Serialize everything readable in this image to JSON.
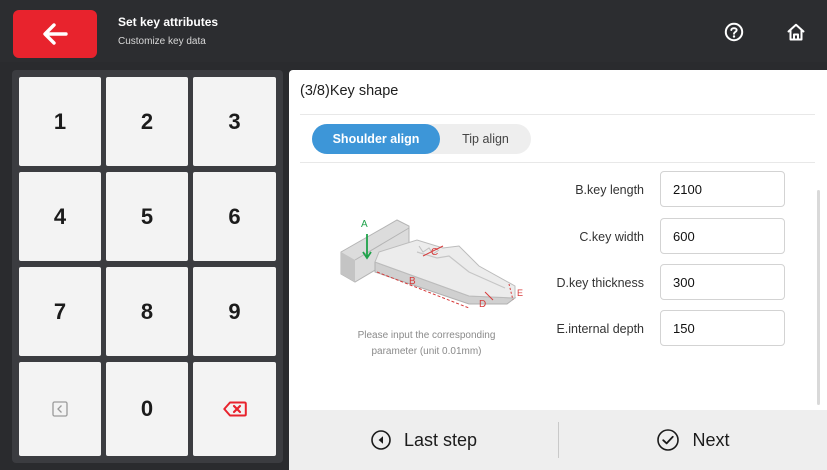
{
  "header": {
    "title": "Set key attributes",
    "subtitle": "Customize key data",
    "back_icon": "back-arrow-icon",
    "help_icon": "help-icon",
    "home_icon": "home-icon",
    "accent": "#e8232d"
  },
  "keypad": {
    "keys": [
      "1",
      "2",
      "3",
      "4",
      "5",
      "6",
      "7",
      "8",
      "9",
      "",
      "0",
      ""
    ],
    "left_icon": "cursor-left-icon",
    "delete_icon": "backspace-icon"
  },
  "panel": {
    "title": "(3/8)Key shape",
    "tabs": [
      {
        "label": "Shoulder align",
        "active": true
      },
      {
        "label": "Tip align",
        "active": false
      }
    ],
    "diagram_labels": [
      "A",
      "B",
      "C",
      "D",
      "E"
    ],
    "hint_line1": "Please input the corresponding",
    "hint_line2": "parameter (unit 0.01mm)",
    "fields": [
      {
        "label": "B.key length",
        "value": "2100"
      },
      {
        "label": "C.key width",
        "value": "600"
      },
      {
        "label": "D.key thickness",
        "value": "300"
      },
      {
        "label": "E.internal depth",
        "value": "150"
      }
    ],
    "tab_color": "#3d96d8"
  },
  "footer": {
    "last_step": "Last step",
    "next": "Next"
  }
}
